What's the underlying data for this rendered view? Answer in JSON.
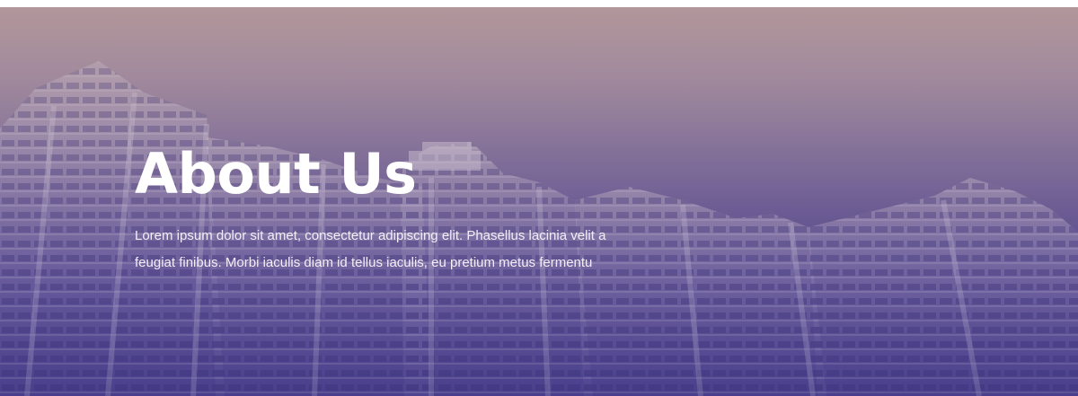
{
  "hero": {
    "title": "About Us",
    "description_line1": "Lorem ipsum dolor sit amet, consectetur adipiscing elit. Phasellus lacinia velit a",
    "description_line2": "feugiat finibus. Morbi iaculis diam id tellus iaculis, eu pretium metus fermentu"
  },
  "colors": {
    "gradient_top": "#b3979a",
    "gradient_bottom": "#3f3381",
    "text": "#ffffff"
  }
}
